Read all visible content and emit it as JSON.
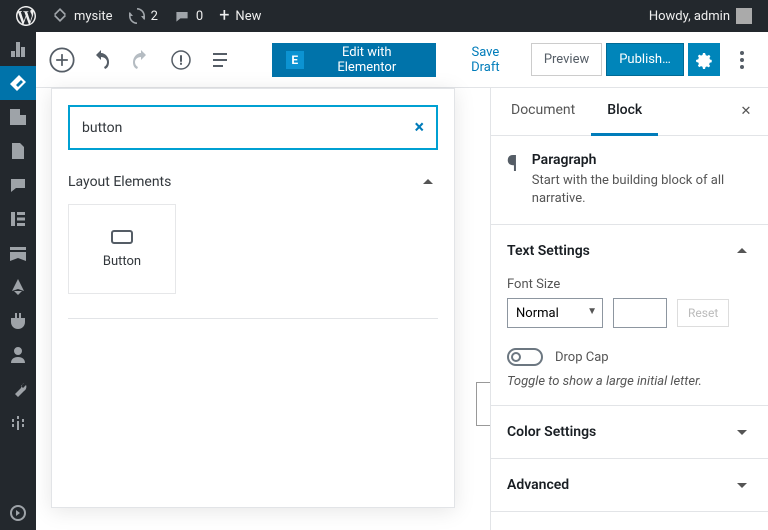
{
  "adminbar": {
    "site": "mysite",
    "updates": "2",
    "comments": "0",
    "new": "New",
    "howdy": "Howdy, admin"
  },
  "toolbar": {
    "elementor": "Edit with Elementor",
    "save_draft": "Save Draft",
    "preview": "Preview",
    "publish": "Publish…"
  },
  "inserter": {
    "search_value": "button",
    "section": "Layout Elements",
    "items": [
      {
        "label": "Button"
      }
    ]
  },
  "sidebar": {
    "tabs": {
      "document": "Document",
      "block": "Block"
    },
    "block_title": "Paragraph",
    "block_desc": "Start with the building block of all narrative.",
    "text_settings": "Text Settings",
    "font_size_label": "Font Size",
    "font_size_value": "Normal",
    "reset": "Reset",
    "drop_cap": "Drop Cap",
    "drop_cap_desc": "Toggle to show a large initial letter.",
    "color_settings": "Color Settings",
    "advanced": "Advanced"
  }
}
